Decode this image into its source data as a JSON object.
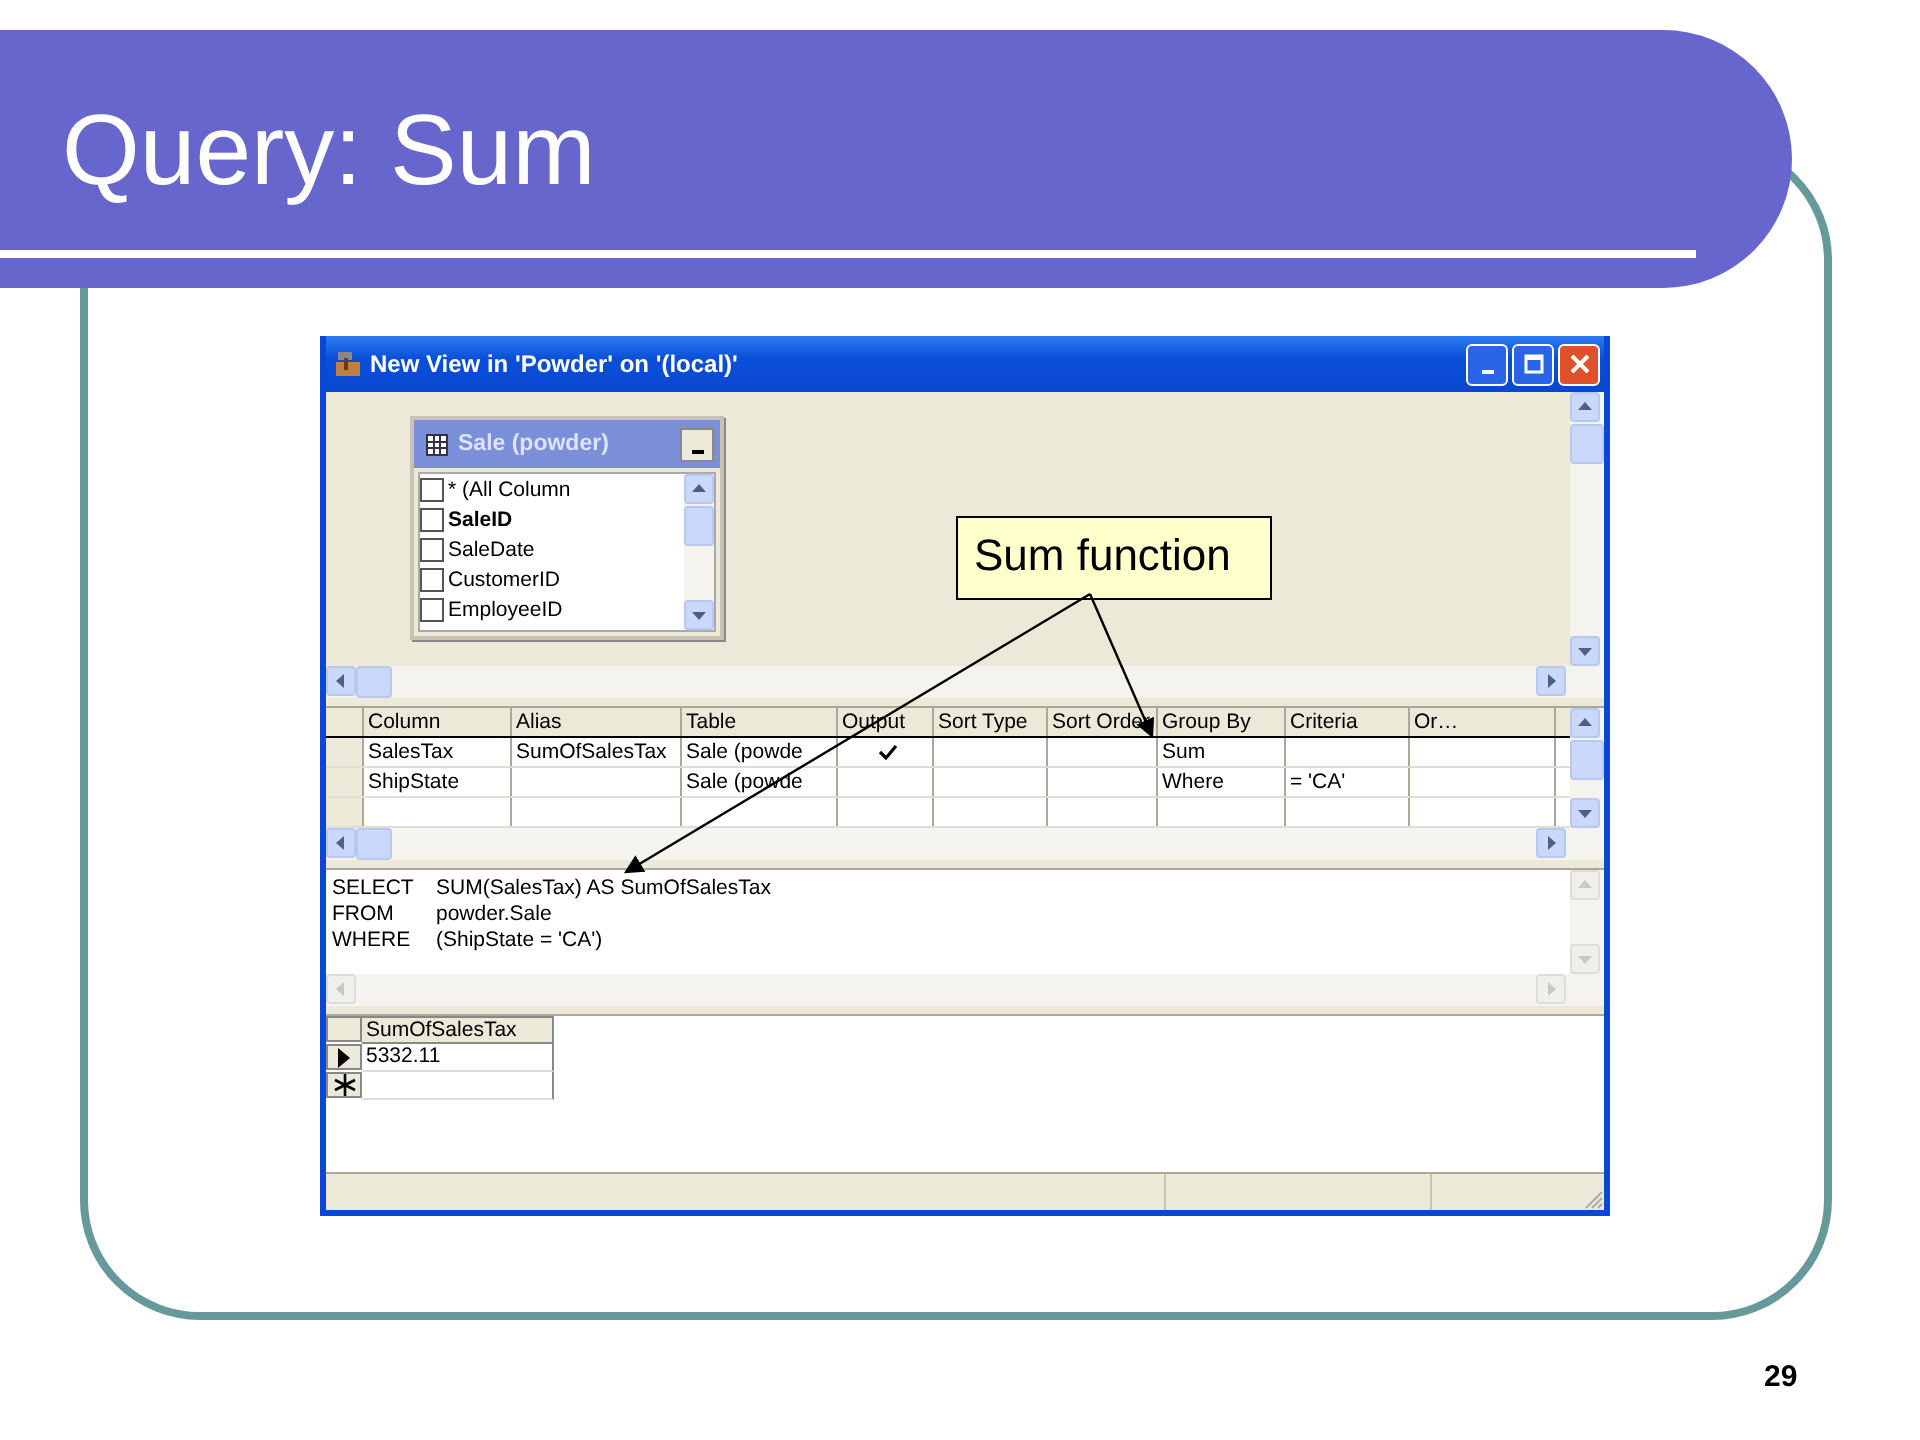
{
  "slide": {
    "title": "Query: Sum",
    "page_number": "29"
  },
  "window": {
    "title": "New View in 'Powder' on '(local)'"
  },
  "table_box": {
    "title": "Sale (powder)",
    "fields": [
      {
        "name": "* (All Column",
        "checked": false,
        "primary_key": false
      },
      {
        "name": "SaleID",
        "checked": false,
        "primary_key": true
      },
      {
        "name": "SaleDate",
        "checked": false,
        "primary_key": false
      },
      {
        "name": "CustomerID",
        "checked": false,
        "primary_key": false
      },
      {
        "name": "EmployeeID",
        "checked": false,
        "primary_key": false
      }
    ]
  },
  "callout": {
    "text": "Sum function"
  },
  "grid": {
    "columns": [
      "Column",
      "Alias",
      "Table",
      "Output",
      "Sort Type",
      "Sort Order",
      "Group By",
      "Criteria",
      "Or…"
    ],
    "rows": [
      {
        "column": "SalesTax",
        "alias": "SumOfSalesTax",
        "table": "Sale (powde",
        "output": true,
        "group_by": "Sum",
        "criteria": ""
      },
      {
        "column": "ShipState",
        "alias": "",
        "table": "Sale (powde",
        "output": false,
        "group_by": "Where",
        "criteria": "= 'CA'"
      }
    ]
  },
  "sql": [
    {
      "keyword": "SELECT",
      "text": "SUM(SalesTax) AS SumOfSalesTax"
    },
    {
      "keyword": "FROM",
      "text": "powder.Sale"
    },
    {
      "keyword": "WHERE",
      "text": "(ShipState = 'CA')"
    }
  ],
  "results": {
    "columns": [
      "SumOfSalesTax"
    ],
    "rows": [
      {
        "kind": "current",
        "values": [
          "5332.11"
        ]
      },
      {
        "kind": "new",
        "values": []
      }
    ]
  }
}
